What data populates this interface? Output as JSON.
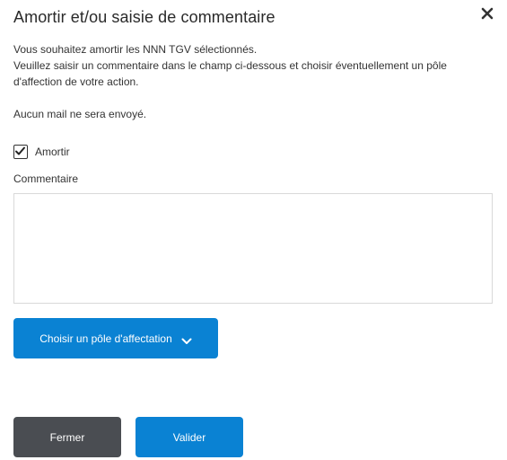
{
  "dialog": {
    "title": "Amortir et/ou saisie de commentaire",
    "close_icon": "close-icon",
    "intro_line1": "Vous souhaitez amortir les NNN TGV sélectionnés.",
    "intro_line2": "Veuillez saisir un commentaire dans le champ ci-dessous et choisir éventuellement un pôle",
    "intro_line3": "d'affection de votre action.",
    "mail_notice": "Aucun mail ne sera envoyé.",
    "checkbox": {
      "label": "Amortir",
      "checked": true
    },
    "comment": {
      "label": "Commentaire",
      "value": ""
    },
    "pole_button": {
      "label": "Choisir un pôle d'affectation",
      "icon": "chevron-down-icon"
    },
    "buttons": {
      "close_label": "Fermer",
      "submit_label": "Valider"
    }
  },
  "colors": {
    "primary": "#0a82d3",
    "secondary": "#4a4d52",
    "text": "#333333",
    "border": "#d9d9d9"
  }
}
